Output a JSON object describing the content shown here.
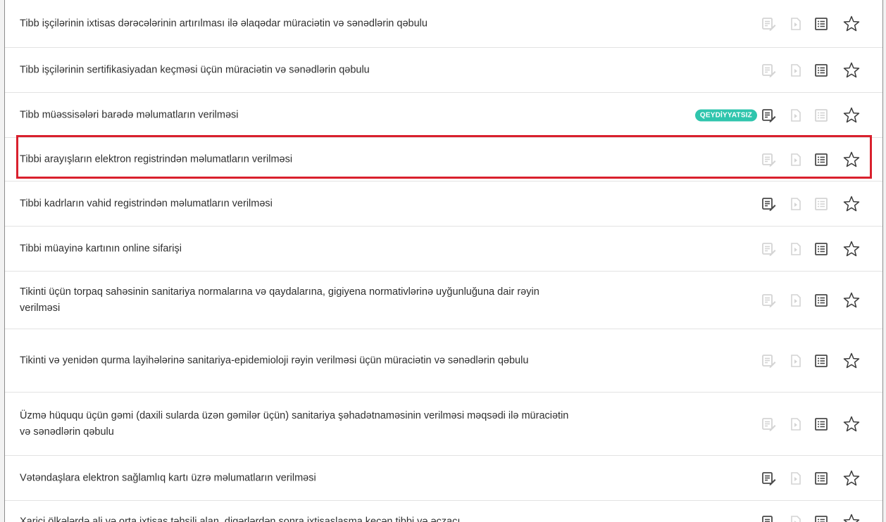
{
  "services": [
    {
      "title": "Tibb işçilərinin ixtisas dərəcələrinin artırılması ilə əlaqədar müraciətin və sənədlərin qəbulu",
      "app": false,
      "pay": false,
      "info": true,
      "badge": ""
    },
    {
      "title": "Tibb işçilərinin sertifikasiyadan keçməsi üçün müraciətin və sənədlərin qəbulu",
      "app": false,
      "pay": false,
      "info": true,
      "badge": ""
    },
    {
      "title": "Tibb müəssisələri barədə məlumatların verilməsi",
      "app": true,
      "pay": false,
      "info": false,
      "badge": "QEYDİYYATSIZ"
    },
    {
      "title": "Tibbi arayışların elektron registrindən məlumatların verilməsi",
      "app": false,
      "pay": false,
      "info": true,
      "badge": "",
      "highlighted": true
    },
    {
      "title": "Tibbi kadrların vahid registrindən məlumatların verilməsi",
      "app": true,
      "pay": false,
      "info": false,
      "badge": ""
    },
    {
      "title": "Tibbi müayinə kartının online sifarişi",
      "app": false,
      "pay": false,
      "info": true,
      "badge": ""
    },
    {
      "title": "Tikinti üçün torpaq sahəsinin sanitariya normalarına və qaydalarına, gigiyena normativlərinə uyğunluğuna dair rəyin verilməsi",
      "app": false,
      "pay": false,
      "info": true,
      "badge": ""
    },
    {
      "title": "Tikinti və yenidən qurma layihələrinə sanitariya-epidemioloji rəyin verilməsi üçün müraciətin və sənədlərin qəbulu",
      "app": false,
      "pay": false,
      "info": true,
      "badge": ""
    },
    {
      "title": "Üzmə hüququ üçün gəmi (daxili sularda üzən gəmilər üçün) sanitariya şəhadətnaməsinin verilməsi məqsədi ilə müraciətin və sənədlərin qəbulu",
      "app": false,
      "pay": false,
      "info": true,
      "badge": ""
    },
    {
      "title": "Vətəndaşlara elektron sağlamlıq kartı üzrə məlumatların verilməsi",
      "app": true,
      "pay": false,
      "info": true,
      "badge": ""
    },
    {
      "title": "Xarici ölkələrdə ali və orta ixtisas təhsili alan, digərlərdən sonra ixtisaslaşma keçən tibbi və əczaçı",
      "app": true,
      "pay": false,
      "info": true,
      "badge": ""
    }
  ],
  "colors": {
    "active_icon": "#4a4a4a",
    "disabled_icon": "#d4d4d4",
    "badge_bg": "#2fc5ad",
    "highlight_border": "#d9202d"
  },
  "icons": {
    "app": "apply-document-icon",
    "pay": "payment-document-icon",
    "info": "info-list-icon",
    "fav": "star-icon"
  }
}
